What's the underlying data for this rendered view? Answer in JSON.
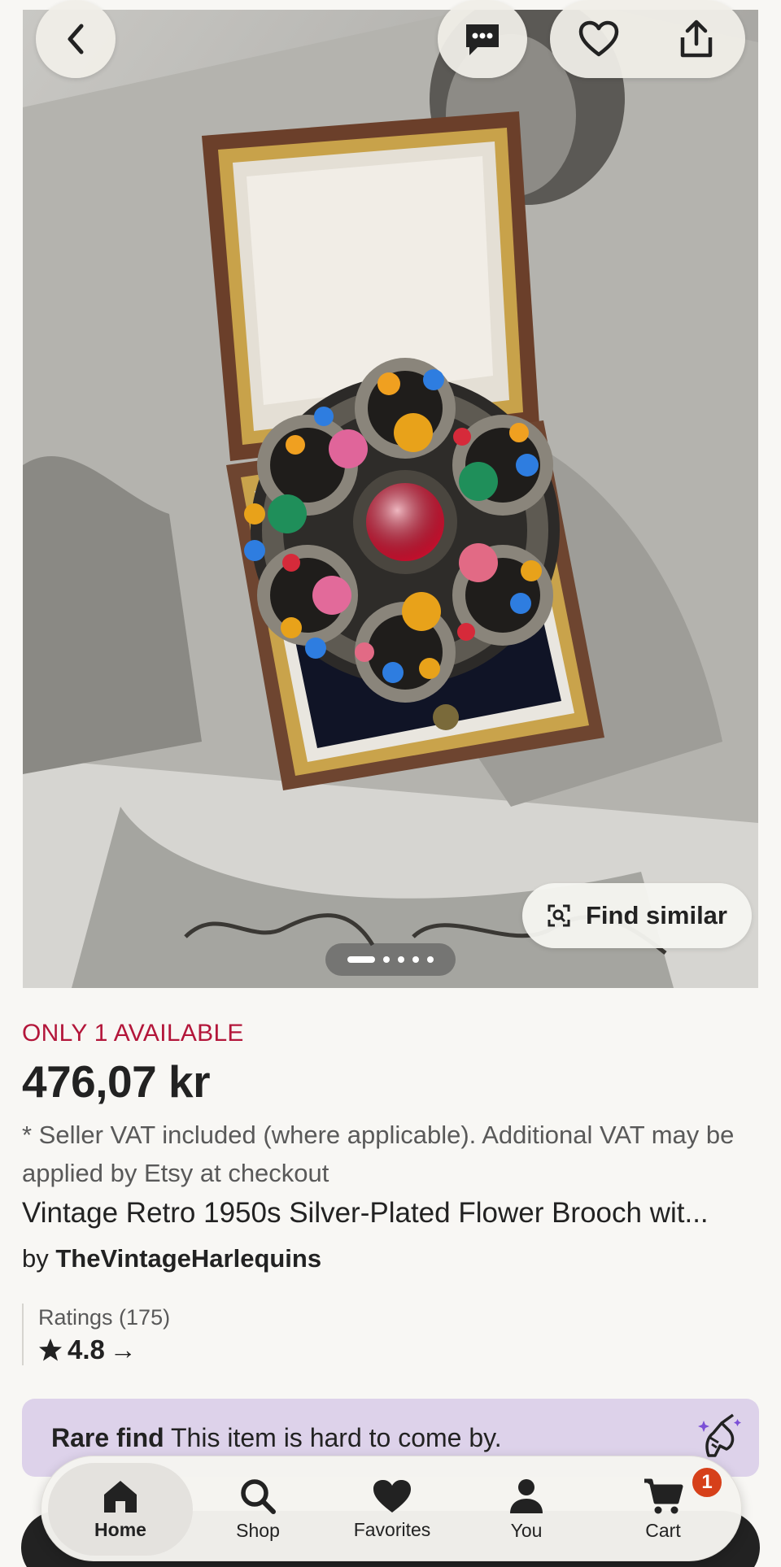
{
  "gallery": {
    "slide_count": 5,
    "active_slide": 1,
    "find_similar_label": "Find similar"
  },
  "header": {
    "back_icon": "chevron-left-icon",
    "message_icon": "message-icon",
    "favorite_icon": "heart-icon",
    "share_icon": "share-icon"
  },
  "listing": {
    "availability": "ONLY 1 AVAILABLE",
    "price": "476,07 kr",
    "vat_note": "* Seller VAT included (where applicable). Additional VAT may be applied by Etsy at checkout",
    "title": "Vintage Retro 1950s Silver-Plated Flower Brooch wit...",
    "by_prefix": "by",
    "shop_name": "TheVintageHarlequins",
    "ratings_label": "Ratings (175)",
    "rating_value": "4.8",
    "rating_arrow": "→"
  },
  "rare_banner": {
    "bold": "Rare find",
    "text": " This item is hard to come by.",
    "icon": "unicorn-icon"
  },
  "bottom_nav": {
    "items": [
      {
        "label": "Home",
        "icon": "home-icon",
        "active": true
      },
      {
        "label": "Shop",
        "icon": "search-icon",
        "active": false
      },
      {
        "label": "Favorites",
        "icon": "heart-icon",
        "active": false
      },
      {
        "label": "You",
        "icon": "person-icon",
        "active": false
      },
      {
        "label": "Cart",
        "icon": "cart-icon",
        "active": false,
        "badge": "1"
      }
    ]
  },
  "colors": {
    "availability": "#b3163a",
    "rare_banner_bg": "#ddd2ea",
    "cart_badge": "#d6401a",
    "page_bg": "#f8f7f4"
  }
}
